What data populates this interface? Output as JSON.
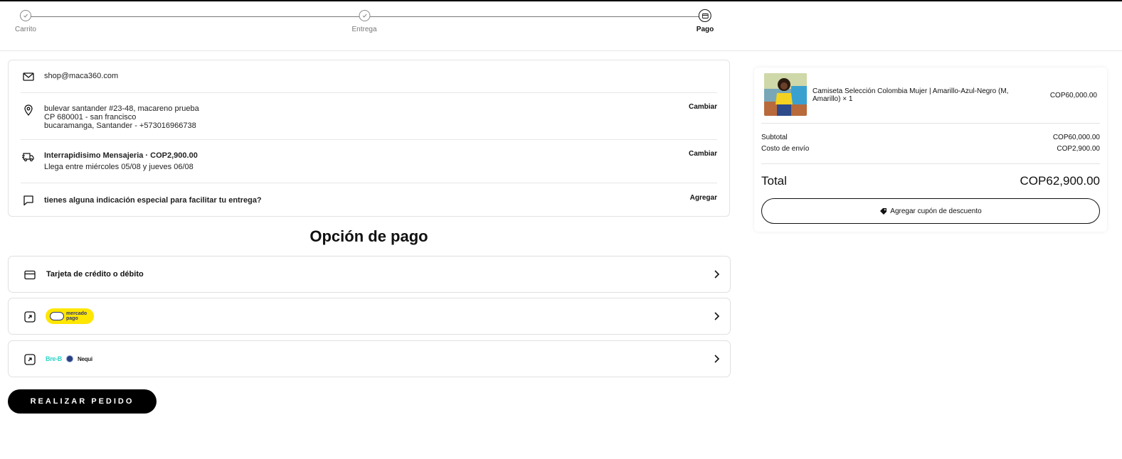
{
  "stepper": {
    "steps": [
      {
        "label": "Carrito",
        "state": "done"
      },
      {
        "label": "Entrega",
        "state": "done"
      },
      {
        "label": "Pago",
        "state": "active"
      }
    ]
  },
  "info": {
    "email": "shop@maca360.com",
    "address": {
      "line1": "bulevar santander #23-48, macareno prueba",
      "line2": "CP 680001 - san francisco",
      "line3": "bucaramanga, Santander - +573016966738",
      "action": "Cambiar"
    },
    "shipping": {
      "method": "Interrapidisimo Mensajeria · COP2,900.00",
      "eta": "Llega entre miércoles 05/08 y jueves 06/08",
      "action": "Cambiar"
    },
    "notes": {
      "prompt": "tienes alguna indicación especial para facilitar tu entrega?",
      "action": "Agregar"
    }
  },
  "payment": {
    "title": "Opción de pago",
    "options": [
      {
        "label": "Tarjeta de crédito o débito"
      },
      {
        "logo": "mercado pago"
      },
      {
        "logos": [
          "Bre-B",
          "Nequi"
        ]
      }
    ],
    "mp_text_line1": "mercado",
    "mp_text_line2": "pago",
    "breb_text": "Bre-B",
    "nequi_text": "Nequi"
  },
  "submit_label": "REALIZAR PEDIDO",
  "summary": {
    "product_name": "Camiseta Selección Colombia Mujer | Amarillo-Azul-Negro (M, Amarillo) × 1",
    "product_price": "COP60,000.00",
    "subtotal_label": "Subtotal",
    "subtotal_value": "COP60,000.00",
    "shipping_label": "Costo de envío",
    "shipping_value": "COP2,900.00",
    "total_label": "Total",
    "total_value": "COP62,900.00",
    "coupon_label": "Agregar cupón de descuento"
  },
  "colors": {
    "mercado_pago_yellow": "#ffe600",
    "bre_b_teal": "#2fd3c8",
    "primary_button": "#000000"
  }
}
